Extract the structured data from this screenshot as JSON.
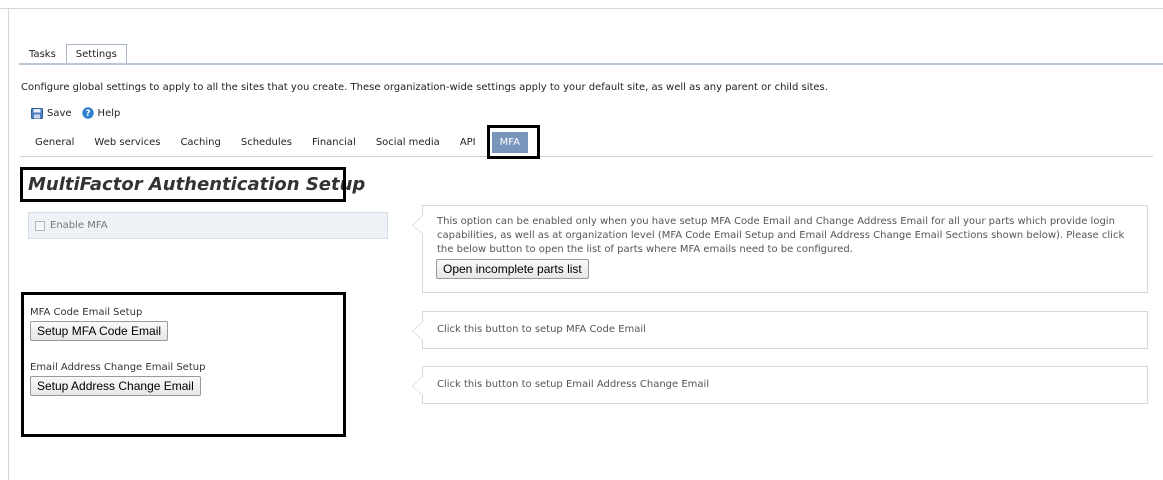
{
  "main_tabs": [
    {
      "label": "Tasks",
      "active": false
    },
    {
      "label": "Settings",
      "active": true
    }
  ],
  "description": "Configure global settings to apply to all the sites that you create. These organization-wide settings apply to your default site, as well as any parent or child sites.",
  "toolbar": {
    "save_label": "Save",
    "help_label": "Help",
    "save_icon": "save-disk-icon",
    "help_icon": "help-question-icon"
  },
  "settings_tabs": [
    {
      "label": "General",
      "active": false
    },
    {
      "label": "Web services",
      "active": false
    },
    {
      "label": "Caching",
      "active": false
    },
    {
      "label": "Schedules",
      "active": false
    },
    {
      "label": "Financial",
      "active": false
    },
    {
      "label": "Social media",
      "active": false
    },
    {
      "label": "API",
      "active": false
    },
    {
      "label": "MFA",
      "active": true
    }
  ],
  "page_title": "MultiFactor Authentication Setup",
  "enable_mfa": {
    "label": "Enable MFA",
    "checked": false
  },
  "info_enable": {
    "text": "This option can be enabled only when you have setup MFA Code Email and Change Address Email for all your parts which provide login capabilities, as well as at organization level (MFA Code Email Setup and Email Address Change Email Sections shown below). Please click the below button to open the list of parts where MFA emails need to be configured.",
    "button_label": "Open incomplete parts list"
  },
  "mfa_code_setup": {
    "label": "MFA Code Email Setup",
    "button_label": "Setup MFA Code Email",
    "info": "Click this button to setup MFA Code Email"
  },
  "address_change_setup": {
    "label": "Email Address Change Email Setup",
    "button_label": "Setup Address Change Email",
    "info": "Click this button to setup Email Address Change Email"
  },
  "colors": {
    "active_tab_bg": "#7a95bc",
    "highlight_border": "#000000",
    "panel_border": "#d6d9dd"
  }
}
